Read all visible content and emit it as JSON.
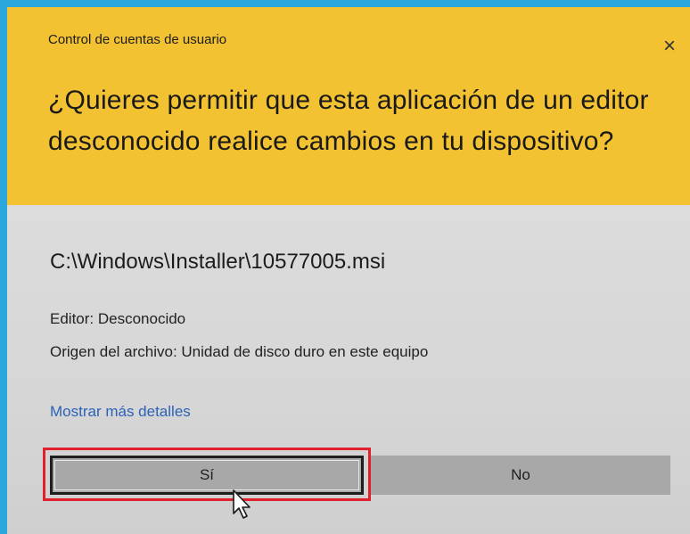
{
  "dialog": {
    "title": "Control de cuentas de usuario",
    "close_glyph": "×",
    "question": "¿Quieres permitir que esta aplicación de un editor desconocido realice cambios en tu dispositivo?",
    "program_path": "C:\\Windows\\Installer\\10577005.msi",
    "publisher": "Editor: Desconocido",
    "origin": "Origen del archivo: Unidad de disco duro en este equipo",
    "details_link": "Mostrar más detalles",
    "yes_label": "Sí",
    "no_label": "No"
  },
  "colors": {
    "header": "#f2c232",
    "body": "#d6d6d6",
    "button": "#a8a8a8",
    "link": "#2b62b8",
    "highlight": "#e0202a",
    "outer_border": "#2aa7dc"
  },
  "icons": [
    "close-icon",
    "mouse-pointer-icon"
  ]
}
